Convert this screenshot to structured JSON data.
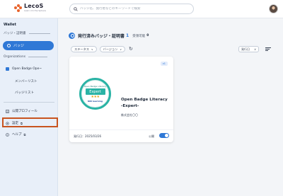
{
  "header": {
    "logo_name": "LecoS",
    "logo_tag": "Learn On the Sphere",
    "search_placeholder": "バッジ名、発行者などのキーワードで検索"
  },
  "sidebar": {
    "title": "Wallet",
    "section_badges": "バッジ・証明書",
    "badge_item": "バッジ",
    "section_orgs": "Organizations",
    "org_name": "Open Badge Ope~",
    "org_members": "メンバーリスト",
    "org_badges": "バッジリスト",
    "public_profile": "公開プロフィール",
    "settings": "設定",
    "help": "ヘルプ"
  },
  "main": {
    "title": "発行済みバッジ・証明書",
    "issued_count": "1",
    "received_label": "受領可能",
    "received_count": "0",
    "filter_status": "ステータス",
    "filter_version": "バージョン",
    "sort_label": "発行日"
  },
  "card": {
    "tag": "v1",
    "badge_ring_text": "Open Badge Literacy",
    "badge_word": "Expert",
    "badge_brand": "NRI learning",
    "name_line1": "Open Badge Literacy",
    "name_line2": "-Expert-",
    "org": "株式会社〇〇",
    "issued_date": "発行日：2025/03/26",
    "public_label": "公開",
    "public_on": true
  },
  "colors": {
    "accent": "#2f78d6",
    "highlight": "#c8541f",
    "badge_teal": "#2ab3a5"
  }
}
